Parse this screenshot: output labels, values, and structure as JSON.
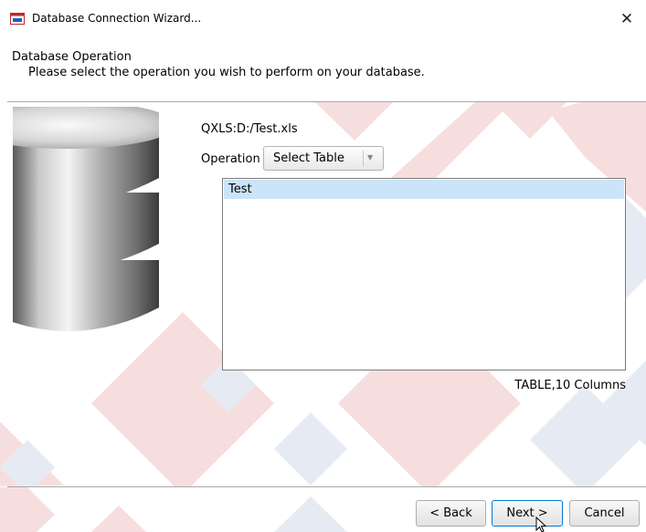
{
  "window": {
    "title": "Database Connection Wizard...",
    "close_glyph": "✕",
    "icon": "wizard-window-icon"
  },
  "header": {
    "title": "Database Operation",
    "subtitle": "Please select the operation you wish to perform on your database."
  },
  "connection": {
    "source": "QXLS:D:/Test.xls"
  },
  "operation": {
    "label": "Operation",
    "selected": "Select Table",
    "arrow": "▼"
  },
  "tables": {
    "items": [
      {
        "name": "Test",
        "selected": true
      }
    ],
    "info": "TABLE,10 Columns"
  },
  "buttons": {
    "back": "< Back",
    "next": "Next >",
    "cancel": "Cancel"
  },
  "colors": {
    "selection": "#cce4f7",
    "deco_red": "#f6dcdc",
    "deco_blue": "#e5eaf2",
    "focus_border": "#0078d7"
  }
}
